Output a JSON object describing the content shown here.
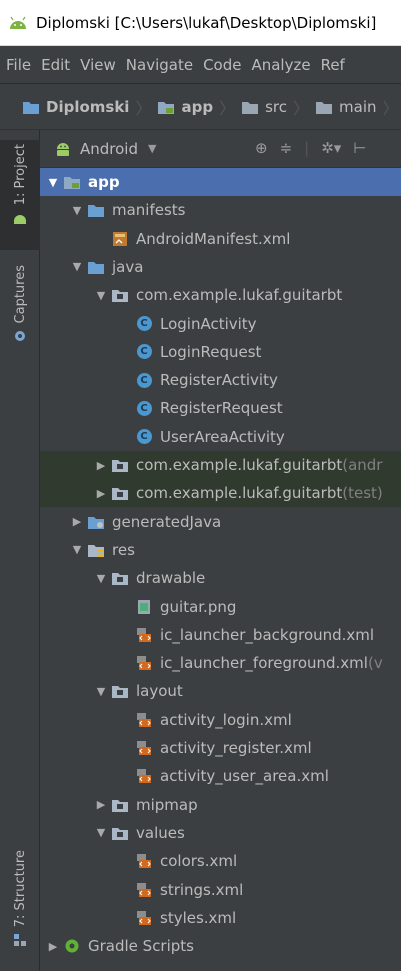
{
  "window": {
    "title": "Diplomski [C:\\Users\\lukaf\\Desktop\\Diplomski]"
  },
  "menu": {
    "items": [
      "File",
      "Edit",
      "View",
      "Navigate",
      "Code",
      "Analyze",
      "Ref"
    ]
  },
  "breadcrumb": [
    "Diplomski",
    "app",
    "src",
    "main"
  ],
  "side_tabs": {
    "project": "1: Project",
    "captures": "Captures",
    "structure": "7: Structure"
  },
  "panel": {
    "view": "Android"
  },
  "tree": [
    {
      "label": "app",
      "icon": "module-folder-icon",
      "arrow": "expanded"
    },
    {
      "label": "manifests",
      "icon": "folder-icon",
      "arrow": "expanded"
    },
    {
      "label": "AndroidManifest.xml",
      "icon": "manifest-file-icon",
      "arrow": "none"
    },
    {
      "label": "java",
      "icon": "folder-icon",
      "arrow": "expanded"
    },
    {
      "label": "com.example.lukaf.guitarbt",
      "icon": "package-icon",
      "arrow": "expanded"
    },
    {
      "label": "LoginActivity",
      "icon": "class-icon",
      "arrow": "none"
    },
    {
      "label": "LoginRequest",
      "icon": "class-icon",
      "arrow": "none"
    },
    {
      "label": "RegisterActivity",
      "icon": "class-icon",
      "arrow": "none"
    },
    {
      "label": "RegisterRequest",
      "icon": "class-icon",
      "arrow": "none"
    },
    {
      "label": "UserAreaActivity",
      "icon": "class-icon",
      "arrow": "none"
    },
    {
      "label": "com.example.lukaf.guitarbt",
      "suffix": "(andr",
      "icon": "package-icon",
      "arrow": "collapsed"
    },
    {
      "label": "com.example.lukaf.guitarbt",
      "suffix": "(test)",
      "icon": "package-icon",
      "arrow": "collapsed"
    },
    {
      "label": "generatedJava",
      "icon": "generated-folder-icon",
      "arrow": "collapsed"
    },
    {
      "label": "res",
      "icon": "res-folder-icon",
      "arrow": "expanded"
    },
    {
      "label": "drawable",
      "icon": "package-icon",
      "arrow": "expanded"
    },
    {
      "label": "guitar.png",
      "icon": "image-file-icon",
      "arrow": "none"
    },
    {
      "label": "ic_launcher_background.xml",
      "icon": "xml-file-icon",
      "arrow": "none"
    },
    {
      "label": "ic_launcher_foreground.xml",
      "suffix": "(v",
      "icon": "xml-file-icon",
      "arrow": "none"
    },
    {
      "label": "layout",
      "icon": "package-icon",
      "arrow": "expanded"
    },
    {
      "label": "activity_login.xml",
      "icon": "xml-file-icon",
      "arrow": "none"
    },
    {
      "label": "activity_register.xml",
      "icon": "xml-file-icon",
      "arrow": "none"
    },
    {
      "label": "activity_user_area.xml",
      "icon": "xml-file-icon",
      "arrow": "none"
    },
    {
      "label": "mipmap",
      "icon": "package-icon",
      "arrow": "collapsed"
    },
    {
      "label": "values",
      "icon": "package-icon",
      "arrow": "expanded"
    },
    {
      "label": "colors.xml",
      "icon": "xml-file-icon",
      "arrow": "none"
    },
    {
      "label": "strings.xml",
      "icon": "xml-file-icon",
      "arrow": "none"
    },
    {
      "label": "styles.xml",
      "icon": "xml-file-icon",
      "arrow": "none"
    },
    {
      "label": "Gradle Scripts",
      "icon": "gradle-icon",
      "arrow": "collapsed"
    }
  ]
}
